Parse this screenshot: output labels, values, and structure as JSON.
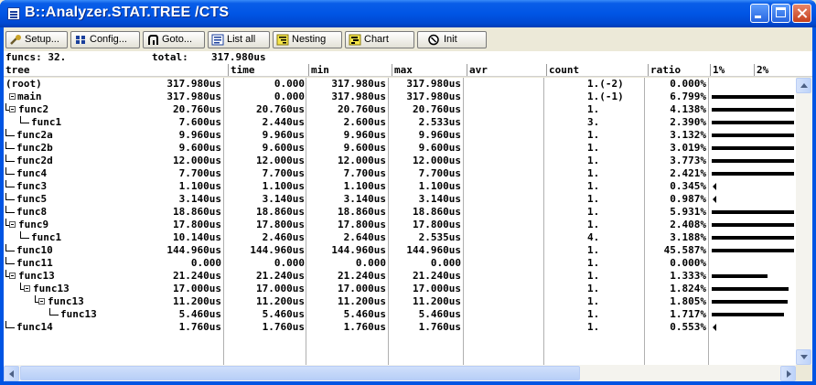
{
  "window": {
    "title": "B::Analyzer.STAT.TREE /CTS"
  },
  "toolbar": {
    "buttons": [
      {
        "label": "Setup...",
        "icon": "wrench-icon"
      },
      {
        "label": "Config...",
        "icon": "config-icon"
      },
      {
        "label": "Goto...",
        "icon": "goto-icon"
      },
      {
        "label": "List all",
        "icon": "list-icon"
      },
      {
        "label": "Nesting",
        "icon": "nesting-icon"
      },
      {
        "label": "Chart",
        "icon": "chart-icon"
      },
      {
        "label": "Init",
        "icon": "init-icon"
      }
    ]
  },
  "info": {
    "funcs": "funcs: 32.",
    "total_label": "total:",
    "total_value": "317.980us"
  },
  "columns": [
    "tree",
    "time",
    "min",
    "max",
    "avr",
    "count",
    "ratio",
    "1%",
    "2%"
  ],
  "rows": [
    {
      "name": "(root)",
      "depth": 0,
      "expand": false,
      "time": "317.980us",
      "min": "0.000",
      "max": "317.980us",
      "avr": "317.980us",
      "count": "1.(-2)",
      "ratio": "0.000%",
      "bar_pct": 0,
      "marker": "none"
    },
    {
      "name": "main",
      "depth": 0,
      "expand": true,
      "time": "317.980us",
      "min": "0.000",
      "max": "317.980us",
      "avr": "317.980us",
      "count": "1.(-1)",
      "ratio": "6.799%",
      "bar_pct": 6.799,
      "marker": "bar"
    },
    {
      "name": "func2",
      "depth": 1,
      "expand": true,
      "time": "20.760us",
      "min": "20.760us",
      "max": "20.760us",
      "avr": "20.760us",
      "count": "1.",
      "ratio": "4.138%",
      "bar_pct": 4.138,
      "marker": "bar"
    },
    {
      "name": "func1",
      "depth": 2,
      "expand": false,
      "time": "7.600us",
      "min": "2.440us",
      "max": "2.600us",
      "avr": "2.533us",
      "count": "3.",
      "ratio": "2.390%",
      "bar_pct": 2.39,
      "marker": "bar"
    },
    {
      "name": "func2a",
      "depth": 1,
      "expand": false,
      "time": "9.960us",
      "min": "9.960us",
      "max": "9.960us",
      "avr": "9.960us",
      "count": "1.",
      "ratio": "3.132%",
      "bar_pct": 3.132,
      "marker": "bar"
    },
    {
      "name": "func2b",
      "depth": 1,
      "expand": false,
      "time": "9.600us",
      "min": "9.600us",
      "max": "9.600us",
      "avr": "9.600us",
      "count": "1.",
      "ratio": "3.019%",
      "bar_pct": 3.019,
      "marker": "bar"
    },
    {
      "name": "func2d",
      "depth": 1,
      "expand": false,
      "time": "12.000us",
      "min": "12.000us",
      "max": "12.000us",
      "avr": "12.000us",
      "count": "1.",
      "ratio": "3.773%",
      "bar_pct": 3.773,
      "marker": "bar"
    },
    {
      "name": "func4",
      "depth": 1,
      "expand": false,
      "time": "7.700us",
      "min": "7.700us",
      "max": "7.700us",
      "avr": "7.700us",
      "count": "1.",
      "ratio": "2.421%",
      "bar_pct": 2.421,
      "marker": "bar"
    },
    {
      "name": "func3",
      "depth": 1,
      "expand": false,
      "time": "1.100us",
      "min": "1.100us",
      "max": "1.100us",
      "avr": "1.100us",
      "count": "1.",
      "ratio": "0.345%",
      "bar_pct": 0.345,
      "marker": "tri"
    },
    {
      "name": "func5",
      "depth": 1,
      "expand": false,
      "time": "3.140us",
      "min": "3.140us",
      "max": "3.140us",
      "avr": "3.140us",
      "count": "1.",
      "ratio": "0.987%",
      "bar_pct": 0.987,
      "marker": "tri"
    },
    {
      "name": "func8",
      "depth": 1,
      "expand": false,
      "time": "18.860us",
      "min": "18.860us",
      "max": "18.860us",
      "avr": "18.860us",
      "count": "1.",
      "ratio": "5.931%",
      "bar_pct": 5.931,
      "marker": "bar"
    },
    {
      "name": "func9",
      "depth": 1,
      "expand": true,
      "time": "17.800us",
      "min": "17.800us",
      "max": "17.800us",
      "avr": "17.800us",
      "count": "1.",
      "ratio": "2.408%",
      "bar_pct": 2.408,
      "marker": "bar"
    },
    {
      "name": "func1",
      "depth": 2,
      "expand": false,
      "time": "10.140us",
      "min": "2.460us",
      "max": "2.640us",
      "avr": "2.535us",
      "count": "4.",
      "ratio": "3.188%",
      "bar_pct": 3.188,
      "marker": "bar"
    },
    {
      "name": "func10",
      "depth": 1,
      "expand": false,
      "time": "144.960us",
      "min": "144.960us",
      "max": "144.960us",
      "avr": "144.960us",
      "count": "1.",
      "ratio": "45.587%",
      "bar_pct": 45.587,
      "marker": "bar"
    },
    {
      "name": "func11",
      "depth": 1,
      "expand": false,
      "time": "0.000",
      "min": "0.000",
      "max": "0.000",
      "avr": "0.000",
      "count": "1.",
      "ratio": "0.000%",
      "bar_pct": 0,
      "marker": "none"
    },
    {
      "name": "func13",
      "depth": 1,
      "expand": true,
      "time": "21.240us",
      "min": "21.240us",
      "max": "21.240us",
      "avr": "21.240us",
      "count": "1.",
      "ratio": "1.333%",
      "bar_pct": 1.333,
      "marker": "bar"
    },
    {
      "name": "func13",
      "depth": 2,
      "expand": true,
      "time": "17.000us",
      "min": "17.000us",
      "max": "17.000us",
      "avr": "17.000us",
      "count": "1.",
      "ratio": "1.824%",
      "bar_pct": 1.824,
      "marker": "bar"
    },
    {
      "name": "func13",
      "depth": 3,
      "expand": true,
      "time": "11.200us",
      "min": "11.200us",
      "max": "11.200us",
      "avr": "11.200us",
      "count": "1.",
      "ratio": "1.805%",
      "bar_pct": 1.805,
      "marker": "bar"
    },
    {
      "name": "func13",
      "depth": 4,
      "expand": false,
      "time": "5.460us",
      "min": "5.460us",
      "max": "5.460us",
      "avr": "5.460us",
      "count": "1.",
      "ratio": "1.717%",
      "bar_pct": 1.717,
      "marker": "bar"
    },
    {
      "name": "func14",
      "depth": 1,
      "expand": false,
      "time": "1.760us",
      "min": "1.760us",
      "max": "1.760us",
      "avr": "1.760us",
      "count": "1.",
      "ratio": "0.553%",
      "bar_pct": 0.553,
      "marker": "tri"
    }
  ]
}
